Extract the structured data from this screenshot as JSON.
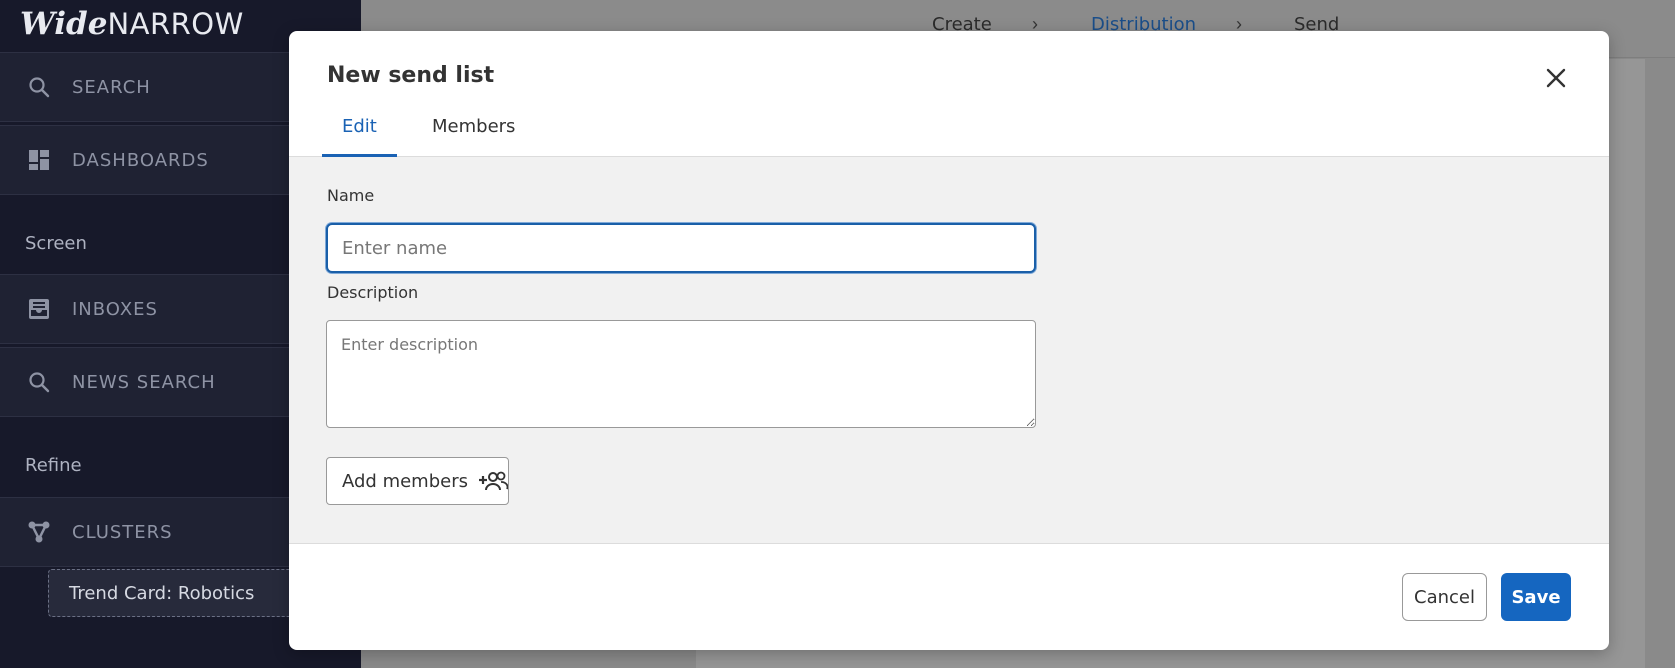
{
  "app": {
    "logo_wide": "Wide",
    "logo_narrow": "NARROW"
  },
  "sidebar": {
    "items": [
      {
        "label": "SEARCH",
        "icon": "search-icon"
      },
      {
        "label": "DASHBOARDS",
        "icon": "dashboard-icon"
      },
      {
        "label": "INBOXES",
        "icon": "inbox-icon"
      },
      {
        "label": "NEWS SEARCH",
        "icon": "search-icon"
      },
      {
        "label": "CLUSTERS",
        "icon": "clusters-icon"
      }
    ],
    "sections": {
      "screen": "Screen",
      "refine": "Refine"
    },
    "trend_card": "Trend Card: Robotics"
  },
  "breadcrumb": {
    "step1": "Create",
    "step2": "Distribution",
    "step3": "Send",
    "separator": "›"
  },
  "modal": {
    "title": "New send list",
    "tabs": {
      "edit": "Edit",
      "members": "Members"
    },
    "name_label": "Name",
    "name_placeholder": "Enter name",
    "name_value": "",
    "description_label": "Description",
    "description_placeholder": "Enter description",
    "description_value": "",
    "add_members_label": "Add members",
    "cancel_label": "Cancel",
    "save_label": "Save"
  },
  "colors": {
    "accent": "#1566c0",
    "sidebar_bg": "#17192a",
    "overlay": "#8a8a8a"
  }
}
